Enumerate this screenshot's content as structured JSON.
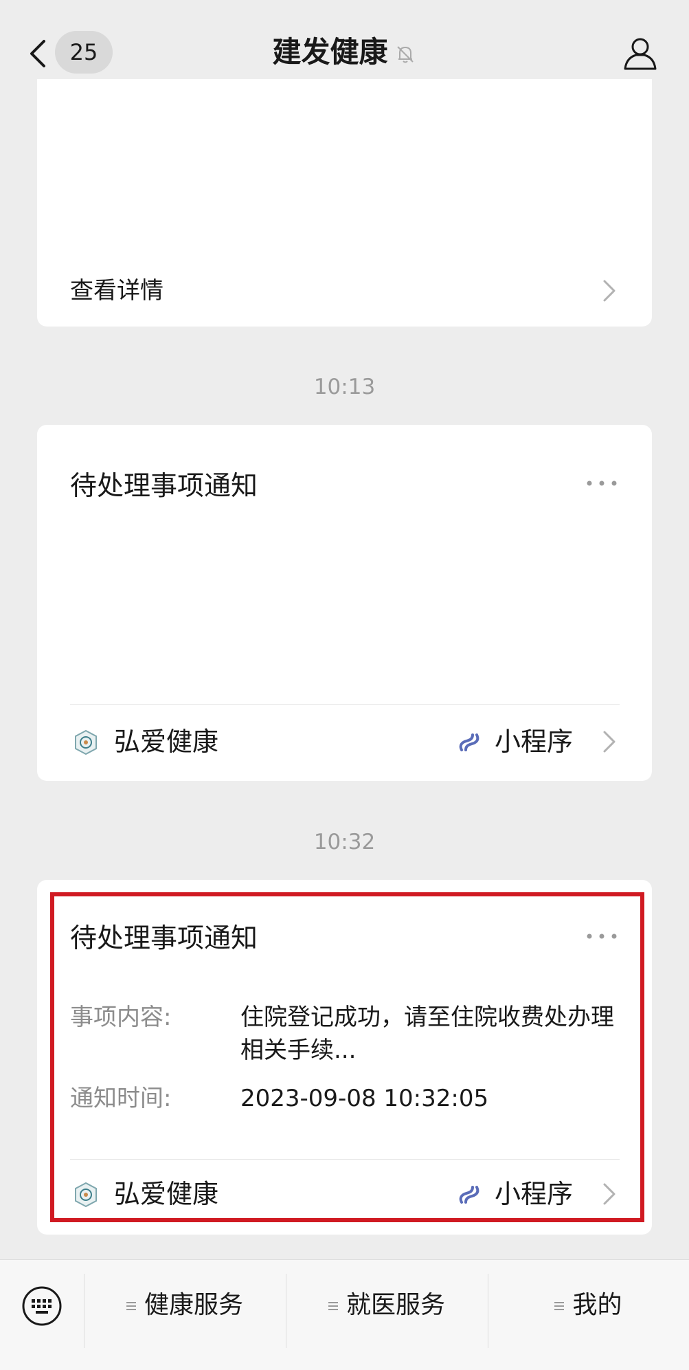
{
  "header": {
    "unread_count": "25",
    "title": "建发健康"
  },
  "card_top": {
    "detail_label": "查看详情"
  },
  "messages": [
    {
      "time": "10:13",
      "title": "待处理事项通知",
      "app_name": "弘爱健康",
      "mini_program_label": "小程序"
    },
    {
      "time": "10:32",
      "title": "待处理事项通知",
      "fields": [
        {
          "label": "事项内容:",
          "value": "住院登记成功，请至住院收费处办理相关手续..."
        },
        {
          "label": "通知时间:",
          "value": "2023-09-08 10:32:05"
        }
      ],
      "app_name": "弘爱健康",
      "mini_program_label": "小程序"
    }
  ],
  "bottom_menu": {
    "items": [
      {
        "label": "健康服务"
      },
      {
        "label": "就医服务"
      },
      {
        "label": "我的"
      }
    ]
  },
  "colors": {
    "background": "#ededed",
    "card": "#ffffff",
    "highlight_border": "#d01a22",
    "mini_program_icon": "#5a6cb8"
  },
  "icons": [
    "back-icon",
    "mute-bell-icon",
    "profile-icon",
    "chevron-right-icon",
    "more-dots-icon",
    "app-logo-icon",
    "mini-program-link-icon",
    "keyboard-icon",
    "menu-lines-icon"
  ]
}
